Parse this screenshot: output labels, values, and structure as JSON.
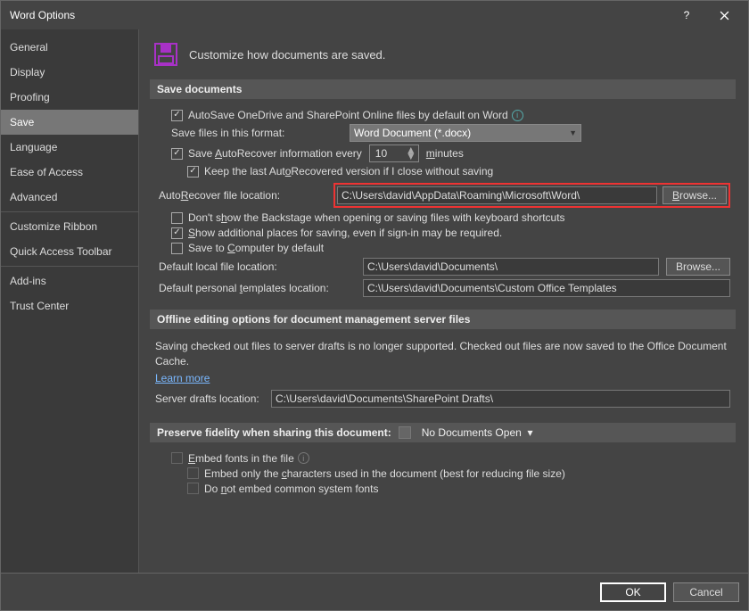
{
  "title": "Word Options",
  "sidebar": {
    "items": [
      {
        "label": "General"
      },
      {
        "label": "Display"
      },
      {
        "label": "Proofing"
      },
      {
        "label": "Save",
        "selected": true
      },
      {
        "label": "Language"
      },
      {
        "label": "Ease of Access"
      },
      {
        "label": "Advanced"
      },
      {
        "label": "Customize Ribbon"
      },
      {
        "label": "Quick Access Toolbar"
      },
      {
        "label": "Add-ins"
      },
      {
        "label": "Trust Center"
      }
    ]
  },
  "header": "Customize how documents are saved.",
  "sections": {
    "save_docs": "Save documents",
    "offline": "Offline editing options for document management server files",
    "preserve": "Preserve fidelity when sharing this document:"
  },
  "save": {
    "autosave_label": "AutoSave OneDrive and SharePoint Online files by default on Word",
    "format_label": "Save files in this format:",
    "format_value": "Word Document (*.docx)",
    "autorecover_label_a": "Save ",
    "autorecover_label_b": "utoRecover information every",
    "autorecover_minutes": "10",
    "minutes_label": "minutes",
    "keep_last_a": "Keep the last Aut",
    "keep_last_b": "Recovered version if I close without saving",
    "ar_location_label_a": "Auto",
    "ar_location_label_b": "ecover file location:",
    "ar_location_value": "C:\\Users\\david\\AppData\\Roaming\\Microsoft\\Word\\",
    "browse": "Browse...",
    "dont_show_a": "Don't s",
    "dont_show_b": "ow the Backstage when opening or saving files with keyboard shortcuts",
    "show_additional_a": "how additional places for saving, even if sign-in may be required.",
    "save_computer_a": "Save to ",
    "save_computer_b": "omputer by default",
    "default_local_label": "Default local file location:",
    "default_local_value": "C:\\Users\\david\\Documents\\",
    "personal_templates_label_a": "Default personal ",
    "personal_templates_label_b": "emplates location:",
    "personal_templates_value": "C:\\Users\\david\\Documents\\Custom Office Templates"
  },
  "offline": {
    "note": "Saving checked out files to server drafts is no longer supported. Checked out files are now saved to the Office Document Cache.",
    "learn": "Learn more",
    "drafts_label": "Server drafts location:",
    "drafts_value": "C:\\Users\\david\\Documents\\SharePoint Drafts\\"
  },
  "preserve": {
    "doc": "No Documents Open",
    "embed_a": "mbed fonts in the file",
    "embed_only_a": "Embed only the ",
    "embed_only_b": "haracters used in the document (best for reducing file size)",
    "do_not_a": "Do ",
    "do_not_b": "ot embed common system fonts"
  },
  "footer": {
    "ok": "OK",
    "cancel": "Cancel"
  }
}
